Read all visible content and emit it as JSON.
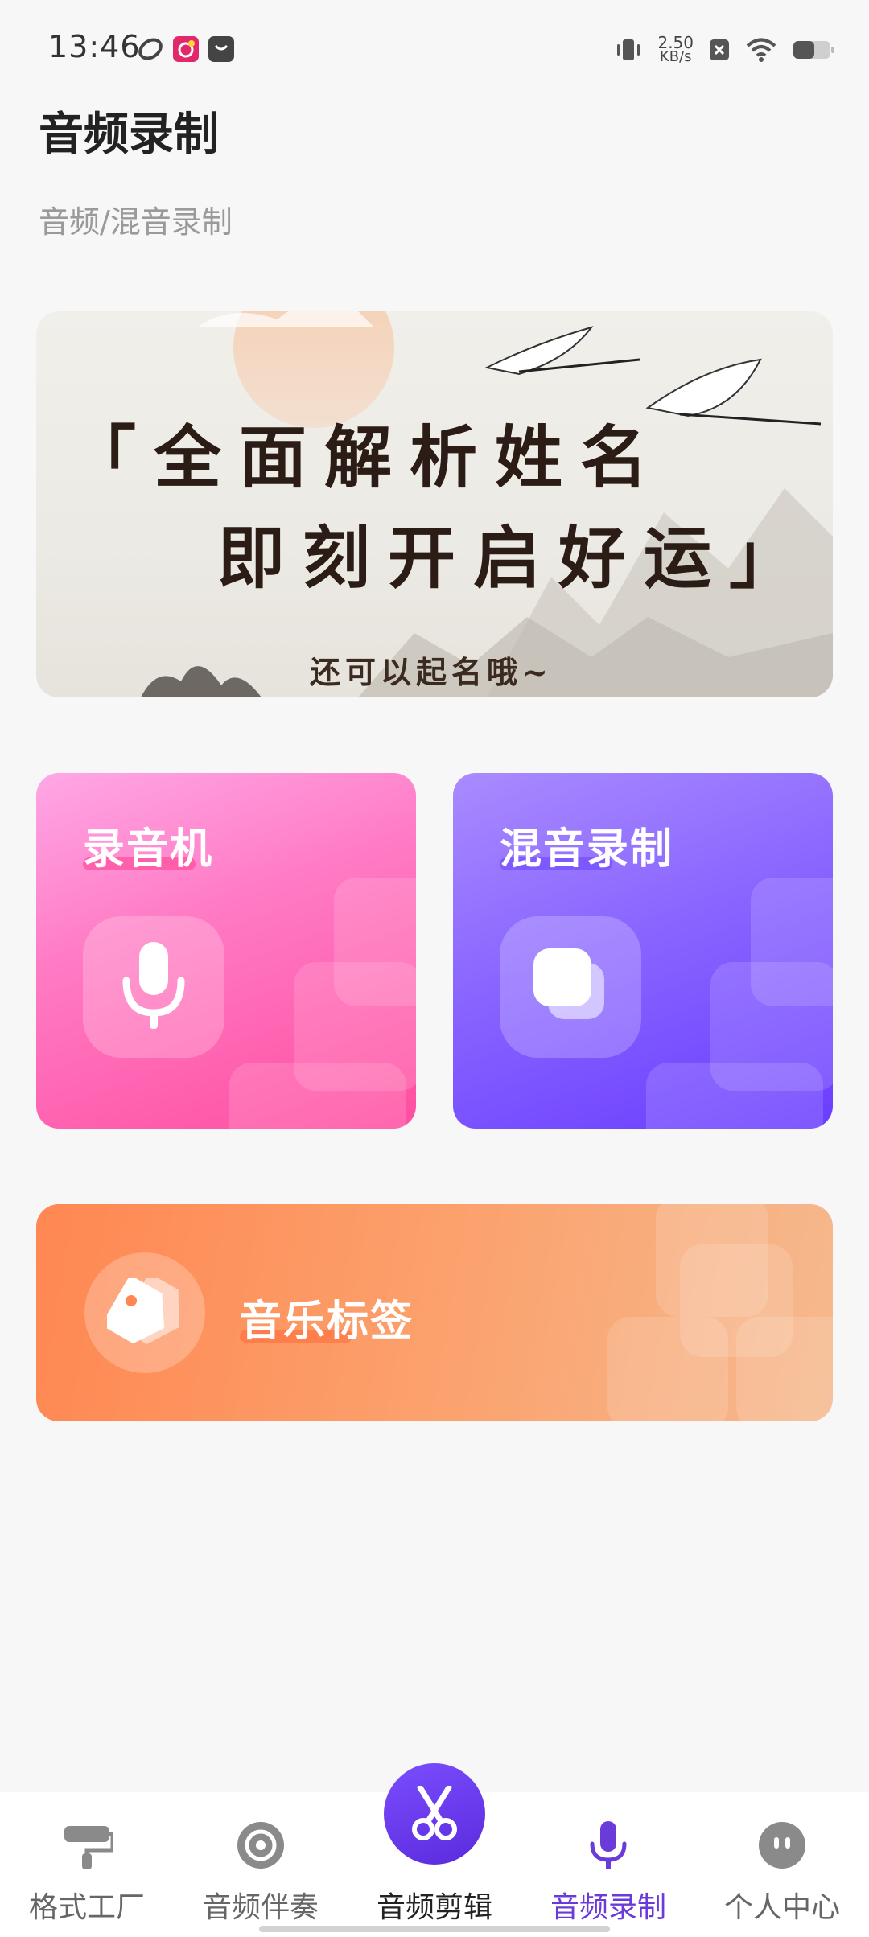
{
  "status_bar": {
    "time": "13:46",
    "net_speed_value": "2.50",
    "net_speed_unit": "KB/s",
    "icons": [
      "app-notification-icon",
      "music-app-icon",
      "shop-icon",
      "vibrate-icon",
      "no-sim-icon",
      "wifi-icon",
      "battery-icon"
    ]
  },
  "header": {
    "title": "音频录制",
    "subtitle": "音频/混音录制"
  },
  "banner": {
    "line1": "「全面解析姓名",
    "line2": "即刻开启好运」",
    "sub": "还可以起名哦~"
  },
  "cards": {
    "recorder": {
      "label": "录音机",
      "icon": "microphone-icon",
      "accent": "#ff4ea0"
    },
    "mix": {
      "label": "混音录制",
      "icon": "layers-icon",
      "accent": "#6a3dff"
    },
    "tags": {
      "label": "音乐标签",
      "icon": "tag-icon",
      "accent": "#ff8752"
    }
  },
  "bottom_nav": {
    "items": [
      {
        "label": "格式工厂",
        "icon": "paint-roller-icon"
      },
      {
        "label": "音频伴奏",
        "icon": "disc-icon"
      },
      {
        "label": "音频剪辑",
        "icon": "scissors-icon"
      },
      {
        "label": "音频录制",
        "icon": "microphone-icon"
      },
      {
        "label": "个人中心",
        "icon": "face-icon"
      }
    ],
    "active_index": 3,
    "active_color": "#6a3bd8"
  }
}
